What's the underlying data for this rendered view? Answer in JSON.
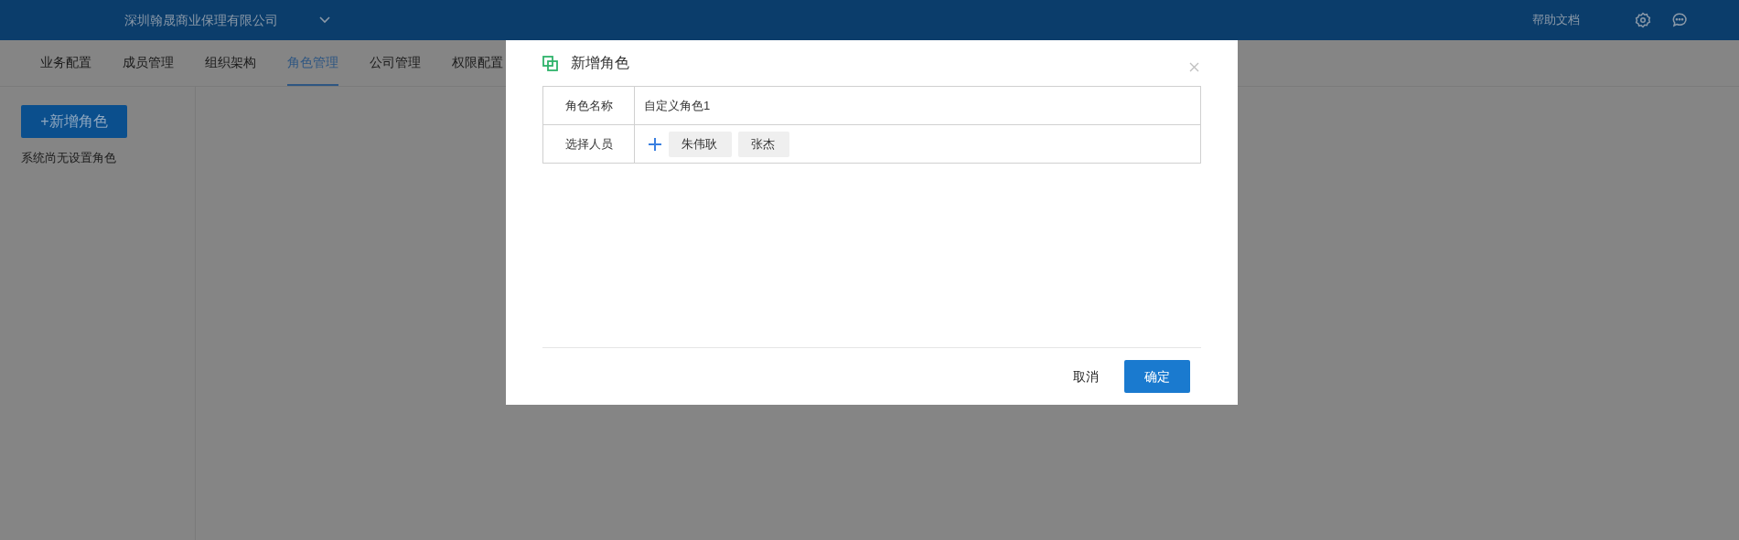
{
  "header": {
    "company": "深圳翰晟商业保理有限公司",
    "help": "帮助文档"
  },
  "tabs": [
    {
      "label": "业务配置",
      "selected": false
    },
    {
      "label": "成员管理",
      "selected": false
    },
    {
      "label": "组织架构",
      "selected": false
    },
    {
      "label": "角色管理",
      "selected": true
    },
    {
      "label": "公司管理",
      "selected": false
    },
    {
      "label": "权限配置",
      "selected": false
    }
  ],
  "sidebar": {
    "add_button": "+新增角色",
    "empty_text": "系统尚无设置角色"
  },
  "dialog": {
    "title": "新增角色",
    "role_name_label": "角色名称",
    "role_name_value": "自定义角色1",
    "members_label": "选择人员",
    "members": [
      "朱伟耿",
      "张杰"
    ],
    "cancel": "取消",
    "confirm": "确定"
  }
}
